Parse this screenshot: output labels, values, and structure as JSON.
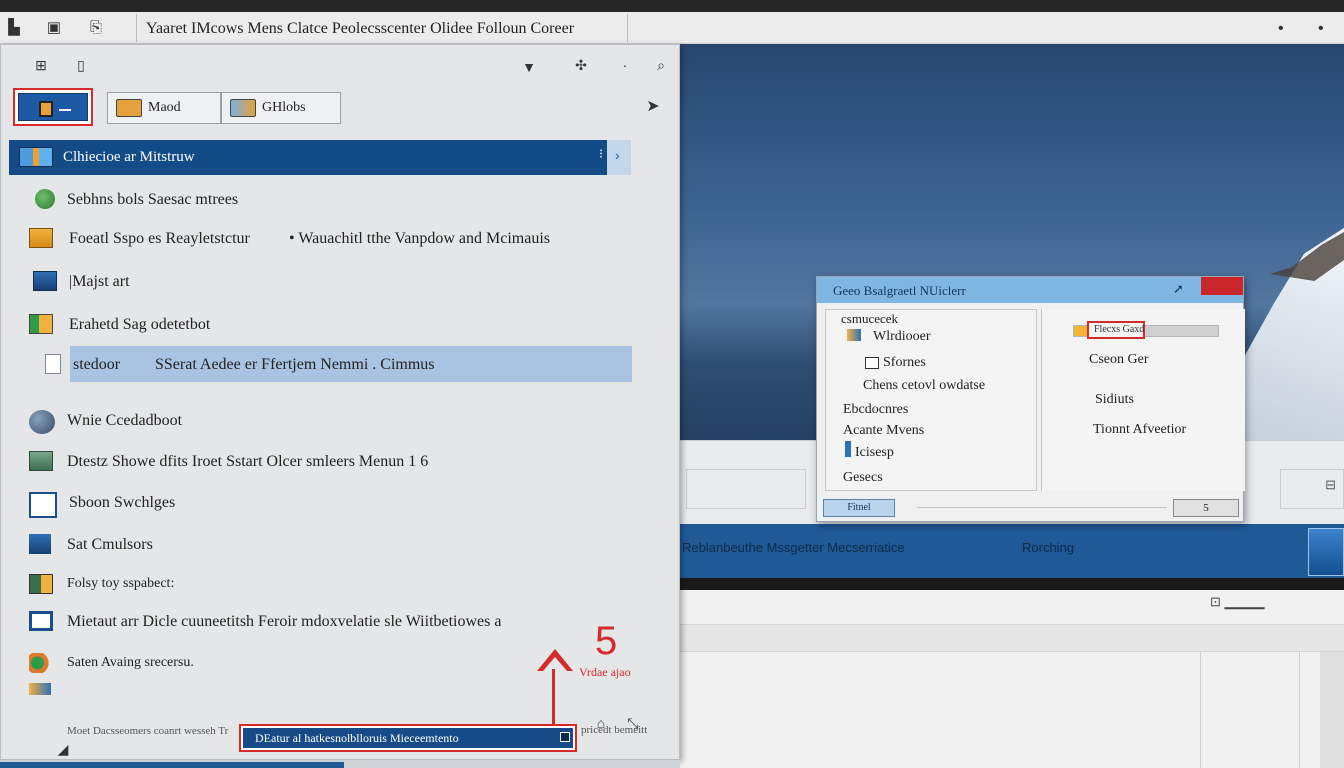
{
  "window": {
    "title": "Yaaret IMcows Mens Clatce Peolecsscenter Olidee Folloun Coreer"
  },
  "panel": {
    "toolbar": {
      "primary_label": "",
      "btn_two": "Maod",
      "btn_three": "GHlobs"
    },
    "selected_item": "Clhiecioe ar Mitstruw",
    "items": [
      {
        "label": "Sebhns bols Saesac mtrees"
      },
      {
        "label": "Foeatl Sspo es Reayletstctur",
        "extra": "Wauachitl tthe Vanpdow and Mcimauis"
      },
      {
        "label": "Majst art"
      },
      {
        "label": "Erahetd Sag odetetbot"
      },
      {
        "label": "stedoor",
        "extra": "SSerat Aedee er Ffertjem Nemmi . Cimmus"
      },
      {
        "label": "Wnie Ccedadboot"
      },
      {
        "label": "Dtestz Showe dfits Iroet Sstart Olcer smleers Menun 1 6"
      },
      {
        "label": "Sboon Swchlges"
      },
      {
        "label": "Sat Cmulsors"
      },
      {
        "label": "Folsy toy sspabect:"
      },
      {
        "label": "Mietaut arr Dicle cuuneetitsh Feroir mdoxvelatie sle Wiitbetiowes a"
      },
      {
        "label": "Saten Avaing srecersu."
      }
    ],
    "bottom_note": "Moet Dacsseomers coanrt wesseh Tr",
    "bottom_input": "DEatur al hatkesnolblloruis Mieceemtento",
    "bottom_note_right": "pricedt bemeitt",
    "callout": {
      "number": "5",
      "label": "Vrdae ajao"
    }
  },
  "dialog": {
    "title": "Geeo Bsalgraetl NUiclerr",
    "left": {
      "header": "csmucecek",
      "items": [
        "Wlrdiooer",
        "Sfornes",
        "Chens cetovl owdatse",
        "Ebcdocnres",
        "Acante Mvens",
        "Icisesp",
        "Gesecs"
      ]
    },
    "right": {
      "progress_label": "Flecxs Gaxd",
      "progress": 0.18,
      "items": [
        "Cseon Ger",
        "Sidiuts",
        "Tionnt Afveetior"
      ]
    },
    "btn_left": "Fitnel",
    "btn_right": "5"
  },
  "desktop": {
    "taskbar_left": "Reblanbeuthe Mssgetter Mecserriatice",
    "taskbar_right": "Rorching"
  },
  "colors": {
    "accent": "#134b86",
    "highlight": "#a9c4e2",
    "callout": "#d62b2b",
    "dialog_header": "#7fb6e2"
  }
}
